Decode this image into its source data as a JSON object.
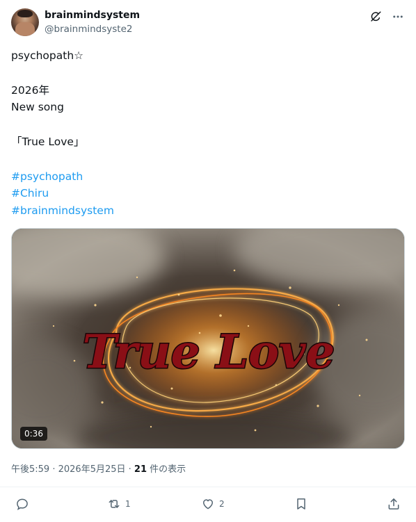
{
  "user": {
    "display_name": "brainmindsystem",
    "handle": "@brainmindsyste2"
  },
  "header_icons": [
    "grok-icon",
    "more-options-icon"
  ],
  "post": {
    "lines": [
      "psychopath☆",
      "",
      "2026年",
      "New song",
      "",
      "「True Love」",
      ""
    ],
    "hashtags": [
      "#psychopath",
      "#Chiru",
      "#brainmindsystem"
    ]
  },
  "media": {
    "title_text": "True Love",
    "duration": "0:36"
  },
  "meta": {
    "time": "午後5:59",
    "sep1": " · ",
    "date": "2026年5月25日",
    "sep2": " · ",
    "views": "21",
    "views_label": " 件の表示"
  },
  "actions": {
    "reply_count": "",
    "repost_count": "1",
    "like_count": "2"
  },
  "colors": {
    "link": "#1d9bf0",
    "text": "#0f1419",
    "muted": "#536471"
  }
}
